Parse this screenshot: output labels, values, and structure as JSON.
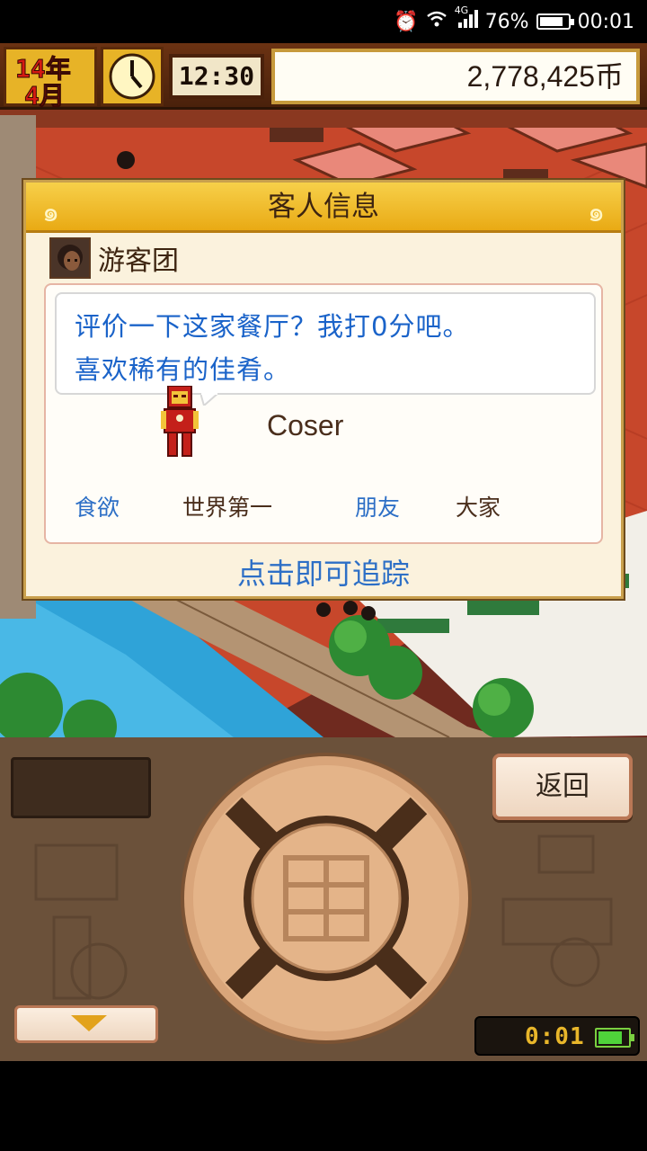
{
  "statusbar": {
    "network": "4G",
    "battery": "76%",
    "battery_level": 0.76,
    "time": "00:01",
    "icons": [
      "alarm-icon",
      "wifi-icon",
      "signal-icon",
      "battery-icon"
    ]
  },
  "hud": {
    "year_label": "14年",
    "month_label": "4月",
    "game_time": "12:30",
    "money": "2,778,425币"
  },
  "dialog": {
    "title": "客人信息",
    "guest_name": "游客团",
    "message_line1": "评价一下这家餐厅？我打0分吧。",
    "message_line2": "喜欢稀有的佳肴。",
    "character_label": "Coser",
    "tags": [
      {
        "label": "食欲",
        "color": "blue"
      },
      {
        "label": "世界第一",
        "color": "brown"
      },
      {
        "label": "朋友",
        "color": "blue"
      },
      {
        "label": "大家",
        "color": "brown"
      }
    ],
    "track_link": "点击即可追踪"
  },
  "controls": {
    "back_label": "返回",
    "timer": "0:01",
    "device_battery_level": 0.8
  },
  "colors": {
    "dialog_header": "#f0bd2a",
    "link_blue": "#2d6fc6",
    "panel_brown": "#6b513a",
    "water": "#2fa3d8"
  }
}
